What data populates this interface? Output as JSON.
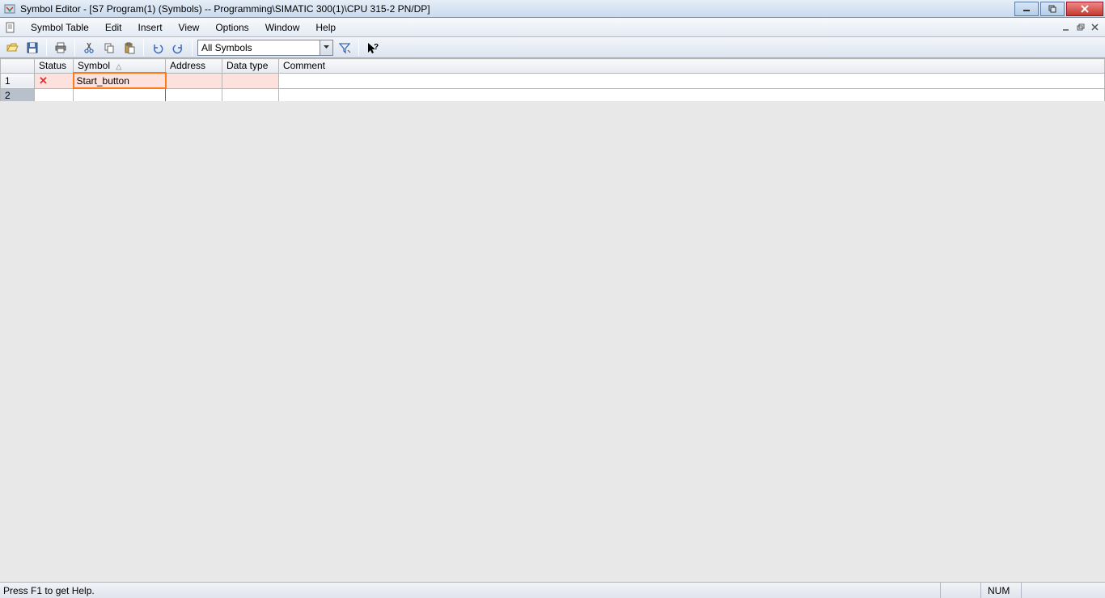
{
  "title": "Symbol Editor - [S7 Program(1) (Symbols) -- Programming\\SIMATIC 300(1)\\CPU 315-2 PN/DP]",
  "menu": {
    "symbol_table": "Symbol Table",
    "edit": "Edit",
    "insert": "Insert",
    "view": "View",
    "options": "Options",
    "window": "Window",
    "help": "Help"
  },
  "toolbar": {
    "filter_value": "All Symbols"
  },
  "grid": {
    "headers": {
      "status": "Status",
      "symbol": "Symbol",
      "address": "Address",
      "datatype": "Data type",
      "comment": "Comment"
    },
    "rows": [
      {
        "num": "1",
        "status": "x",
        "symbol": "Start_button",
        "address": "",
        "datatype": "",
        "comment": "",
        "error": true
      },
      {
        "num": "2",
        "status": "",
        "symbol": "",
        "address": "",
        "datatype": "",
        "comment": "",
        "editing": true
      }
    ]
  },
  "statusbar": {
    "help_text": "Press F1 to get Help.",
    "num_lock": "NUM"
  }
}
